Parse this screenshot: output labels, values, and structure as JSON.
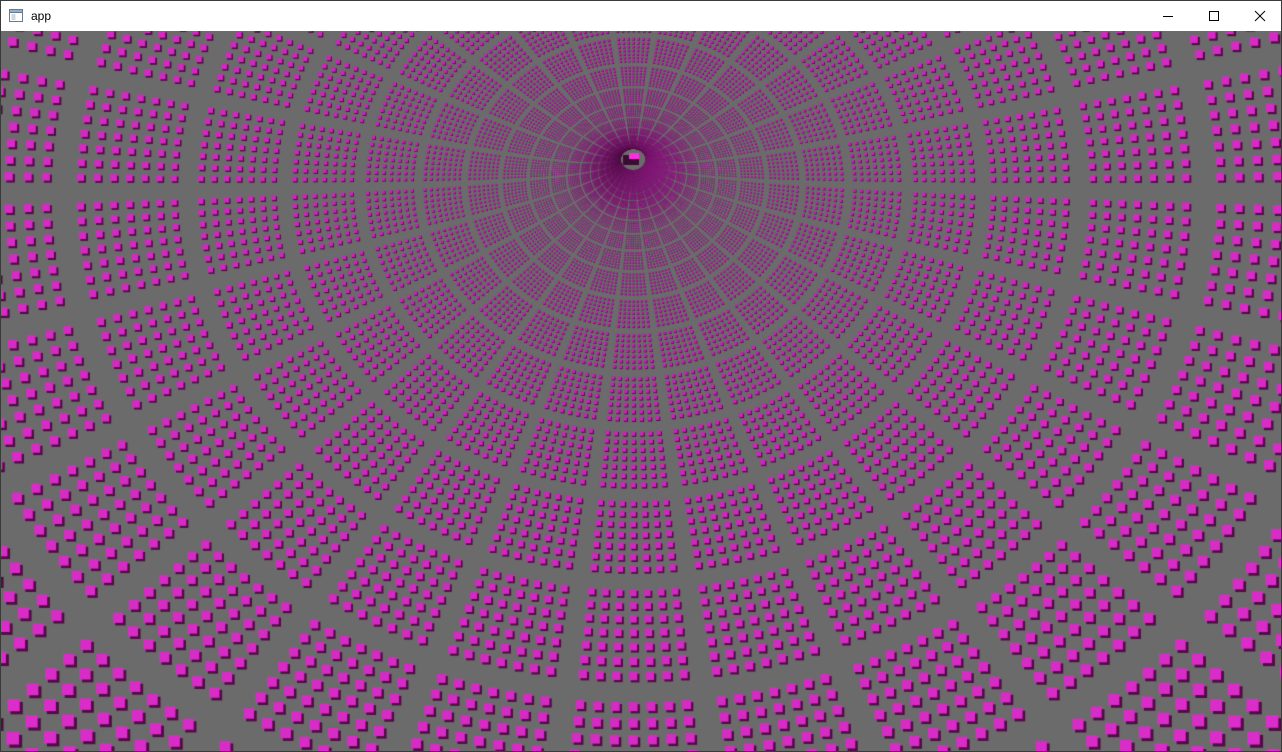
{
  "window": {
    "title": "app",
    "controls": {
      "minimize_icon": "minimize-icon",
      "maximize_icon": "maximize-icon",
      "close_icon": "close-icon"
    }
  },
  "scene": {
    "background_color": "#6b6b6b",
    "cube_color": "#e62fd3",
    "cube_dark_color": "#4a1040",
    "object_color": "#ff2ee0"
  }
}
